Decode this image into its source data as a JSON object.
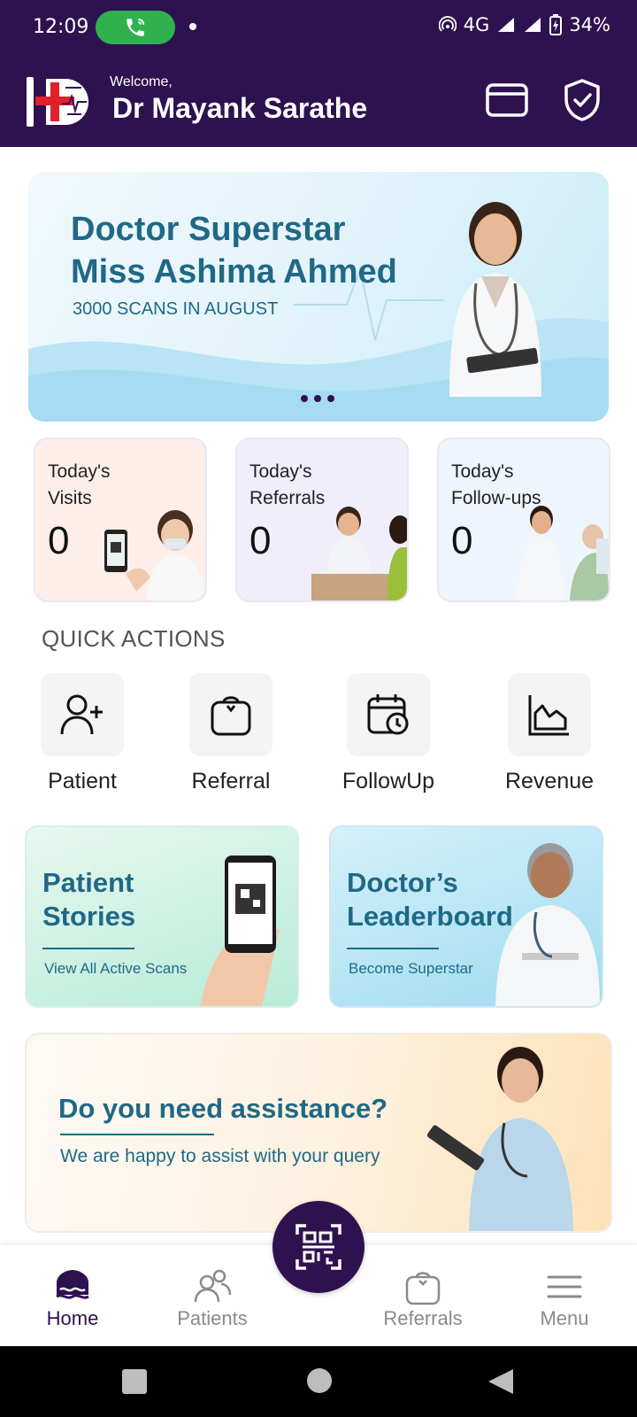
{
  "status_bar": {
    "time": "12:09",
    "network": "4G",
    "battery": "34%"
  },
  "header": {
    "welcome": "Welcome,",
    "doctor_name": "Dr Mayank Sarathe"
  },
  "banner": {
    "line1": "Doctor Superstar",
    "line2": "Miss Ashima Ahmed",
    "subtitle": "3000 SCANS IN AUGUST"
  },
  "stats": [
    {
      "label": "Today's Visits",
      "value": "0"
    },
    {
      "label": "Today's Referrals",
      "value": "0"
    },
    {
      "label": "Today's Follow-ups",
      "value": "0"
    }
  ],
  "quick_actions": {
    "title": "QUICK ACTIONS",
    "items": [
      {
        "label": "Patient",
        "icon": "add-user-icon"
      },
      {
        "label": "Referral",
        "icon": "referral-bag-icon"
      },
      {
        "label": "FollowUp",
        "icon": "calendar-clock-icon"
      },
      {
        "label": "Revenue",
        "icon": "area-chart-icon"
      }
    ]
  },
  "promos": {
    "stories": {
      "title": "Patient Stories",
      "subtitle": "View All Active Scans"
    },
    "leaderboard": {
      "title": "Doctor’s Leaderboard",
      "subtitle": "Become Superstar"
    }
  },
  "assistance": {
    "title": "Do you need assistance?",
    "subtitle": "We are happy to assist with your query"
  },
  "bottom_nav": {
    "items": [
      {
        "label": "Home",
        "icon": "home-icon",
        "active": true
      },
      {
        "label": "Patients",
        "icon": "patients-icon",
        "active": false
      },
      {
        "label": "Referrals",
        "icon": "referrals-icon",
        "active": false
      },
      {
        "label": "Menu",
        "icon": "menu-icon",
        "active": false
      }
    ],
    "center_action_icon": "qr-scan-icon"
  },
  "colors": {
    "primary": "#2e1250",
    "accent_text": "#1f6986",
    "call_green": "#2fb24e"
  }
}
